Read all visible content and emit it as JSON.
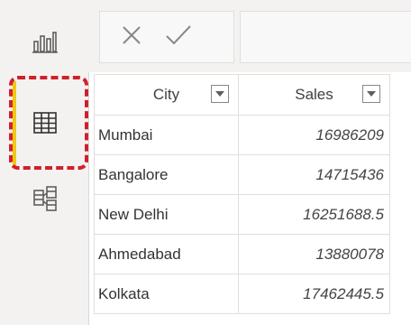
{
  "icons": {
    "report_view": "bar-chart-icon",
    "data_view": "table-grid-icon",
    "model_view": "model-diagram-icon",
    "cancel": "close-icon",
    "commit": "checkmark-icon",
    "dropdown": "chevron-down-icon"
  },
  "colors": {
    "accent": "#f2c811",
    "highlight": "#d0202a",
    "rail_bg": "#f3f2f1",
    "grid_border": "#e1dfdd"
  },
  "table": {
    "columns": [
      {
        "label": "City"
      },
      {
        "label": "Sales"
      }
    ],
    "rows": [
      {
        "city": "Mumbai",
        "sales": "16986209"
      },
      {
        "city": "Bangalore",
        "sales": "14715436"
      },
      {
        "city": "New Delhi",
        "sales": "16251688.5"
      },
      {
        "city": "Ahmedabad",
        "sales": "13880078"
      },
      {
        "city": "Kolkata",
        "sales": "17462445.5"
      }
    ]
  }
}
